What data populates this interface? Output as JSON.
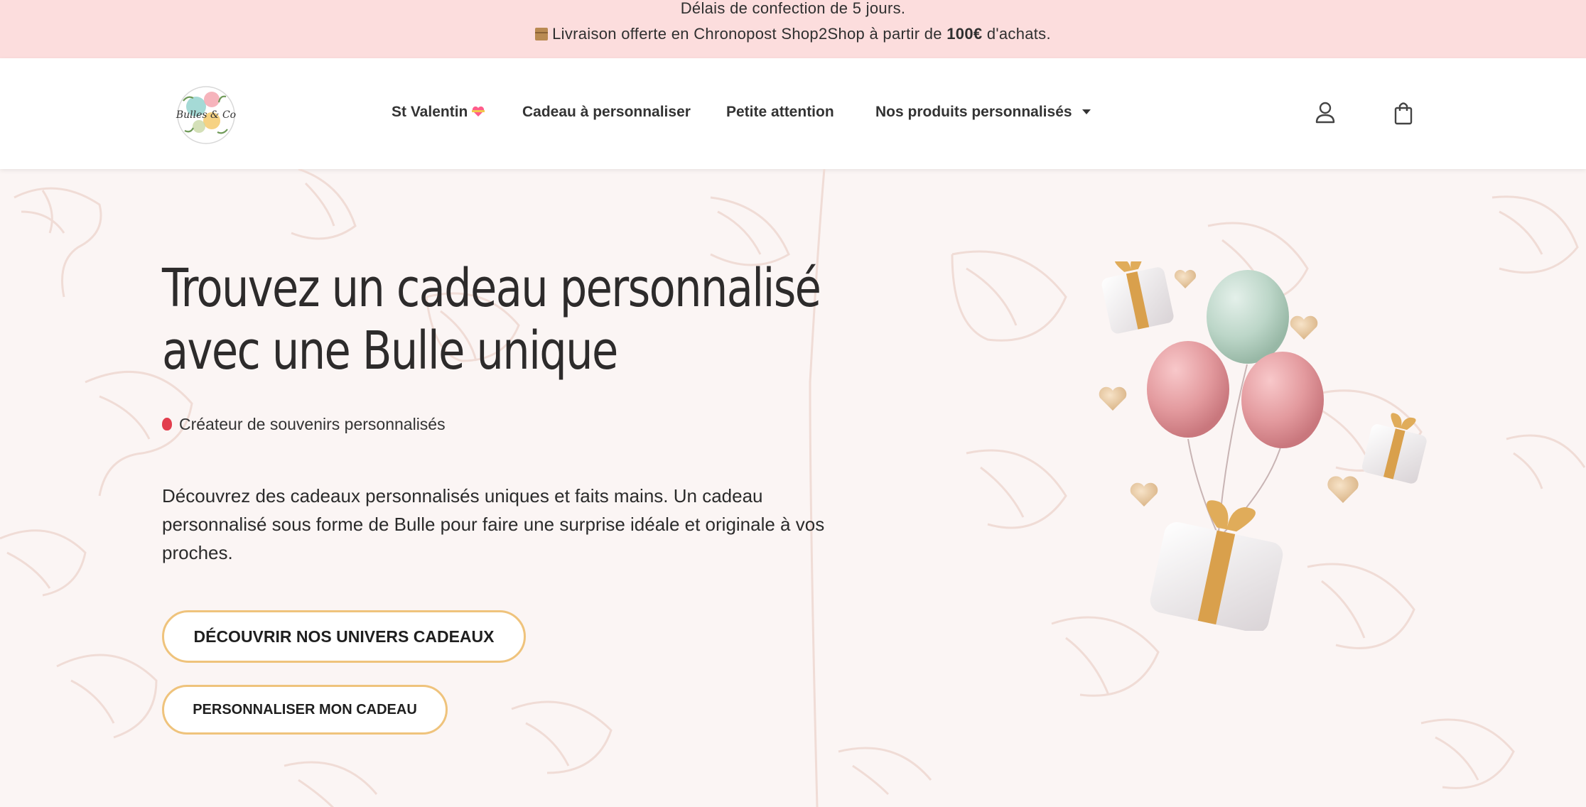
{
  "announcement": {
    "line1": "Délais de confection de 5 jours.",
    "line2_prefix": "Livraison offerte en Chronopost Shop2Shop à partir de ",
    "line2_bold": "100€",
    "line2_suffix": " d'achats."
  },
  "header": {
    "logo_text": "Bulles & Co",
    "nav": [
      {
        "label": "St Valentin",
        "icon": "heart-ribbon-emoji"
      },
      {
        "label": "Cadeau à personnaliser"
      },
      {
        "label": "Petite attention"
      },
      {
        "label": "Nos produits personnalisés",
        "has_dropdown": true
      }
    ],
    "icons": [
      "user-icon",
      "cart-icon"
    ]
  },
  "hero": {
    "title_line1": "Trouvez un cadeau personnalisé",
    "title_line2": "avec une Bulle unique",
    "tagline": "Créateur de souvenirs personnalisés",
    "description": "Découvrez des cadeaux personnalisés uniques et faits mains. Un cadeau personnalisé sous forme de Bulle pour faire une surprise idéale et originale à vos proches.",
    "button_primary": "DÉCOUVRIR NOS UNIVERS CADEAUX",
    "button_secondary": "PERSONNALISER MON CADEAU"
  },
  "colors": {
    "topbar_bg": "#fcdddd",
    "hero_bg": "#fbf5f4",
    "button_border": "#efc37c",
    "balloon_pink": "#e39a9e",
    "balloon_mint": "#bcd6c8",
    "ribbon_gold": "#d9a04c"
  }
}
